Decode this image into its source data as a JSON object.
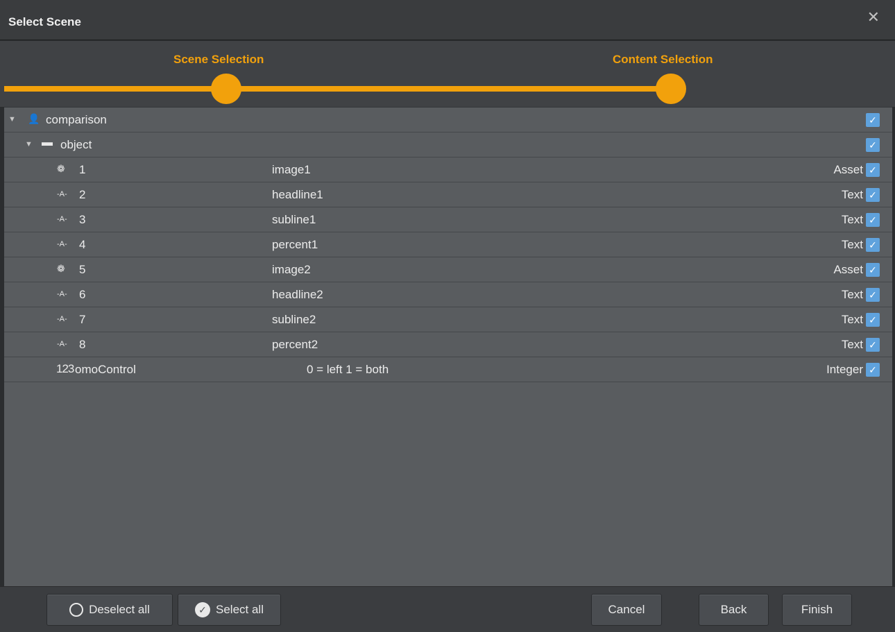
{
  "window": {
    "title": "Select Scene",
    "close_glyph": "✕"
  },
  "wizard": {
    "steps": [
      {
        "label": "Scene Selection"
      },
      {
        "label": "Content Selection"
      }
    ],
    "accent_color": "#f2a10c"
  },
  "tree": {
    "rows": [
      {
        "kind": "scene",
        "icon": "user-icon",
        "name": "comparison",
        "desc": "",
        "type": "",
        "checked": true
      },
      {
        "kind": "folder",
        "icon": "folder-icon",
        "name": "object",
        "desc": "",
        "type": "",
        "checked": true
      },
      {
        "kind": "field",
        "icon": "palette-icon",
        "name": "1",
        "desc": "image1",
        "type": "Asset",
        "checked": true
      },
      {
        "kind": "field",
        "icon": "text-field-icon",
        "name": "2",
        "desc": "headline1",
        "type": "Text",
        "checked": true
      },
      {
        "kind": "field",
        "icon": "text-field-icon",
        "name": "3",
        "desc": "subline1",
        "type": "Text",
        "checked": true
      },
      {
        "kind": "field",
        "icon": "text-field-icon",
        "name": "4",
        "desc": "percent1",
        "type": "Text",
        "checked": true
      },
      {
        "kind": "field",
        "icon": "palette-icon",
        "name": "5",
        "desc": "image2",
        "type": "Asset",
        "checked": true
      },
      {
        "kind": "field",
        "icon": "text-field-icon",
        "name": "6",
        "desc": "headline2",
        "type": "Text",
        "checked": true
      },
      {
        "kind": "field",
        "icon": "text-field-icon",
        "name": "7",
        "desc": "subline2",
        "type": "Text",
        "checked": true
      },
      {
        "kind": "field",
        "icon": "text-field-icon",
        "name": "8",
        "desc": "percent2",
        "type": "Text",
        "checked": true
      },
      {
        "kind": "field",
        "icon": "integer-icon",
        "name": "omoControl",
        "desc": "0 = left 1 = both",
        "type": "Integer",
        "checked": true
      }
    ],
    "checkbox_color": "#5fa2dd"
  },
  "footer": {
    "deselect_all": "Deselect all",
    "select_all": "Select all",
    "cancel": "Cancel",
    "back": "Back",
    "finish": "Finish"
  }
}
